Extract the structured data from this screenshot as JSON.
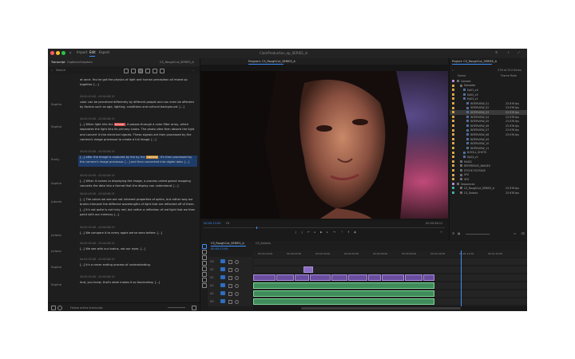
{
  "app": {
    "window_title": "ClarkProduction_ep_SERIES_nl",
    "workspace_tabs": [
      "Import",
      "Edit",
      "Export"
    ],
    "active_workspace": "Edit"
  },
  "left_panel": {
    "tabs": [
      "Transcript",
      "Captions",
      "Graphics"
    ],
    "sequence_name": "CS_RoughCut_SERIES_A",
    "search_placeholder": "Search",
    "footer_label": "Follow active transcript",
    "segments": [
      {
        "speaker": "",
        "timecode": "",
        "text": "at once. You've got the physics of light and human perception all mixed up together. [...]"
      },
      {
        "speaker": "Sophia",
        "timecode": "00:00:05:08 - 00:00:06:19",
        "text": "color can be perceived differently by different people and can even be affected by factors such as age, lighting, conditions and cultural background. [...]"
      },
      {
        "speaker": "Sophia",
        "timecode": "00:00:05:08 - 00:00:06:19",
        "text_before": "[...] When light hits the",
        "highlight": "sensor",
        "text_after": ", it passes through a color filter array, which separates the light into its primary colors. The photo sites then absorb the light and convert it into electrical signals. These signals are then processed by the camera's image processor to create a full image. [...]"
      },
      {
        "speaker": "Emily",
        "timecode": "00:00:05:08 - 00:00:06:19",
        "text_before": "[...] after the image is captured by the by the",
        "highlight": "camera",
        "text_after": ", it's then processed by the camera's image processor. [...] and then converted into digital data. [...]"
      },
      {
        "speaker": "Sophia",
        "timecode": "00:00:05:08 - 00:00:06:19",
        "text": "[...] When it comes to displaying the image, a process called gamut mapping converts the data into a format that the display can understand. [...]"
      },
      {
        "speaker": "Jubrola",
        "timecode": "00:00:05:08 - 00:00:06:19",
        "text": "[...] The colors we see are not inherent properties of optics, but rather way our brains interpret the different wavelengths of light that are reflected off of them. [...] It's not quite is not truly red, but rather a reflection of red light that we then paint with our memory. [...]"
      },
      {
        "speaker": "Juliana",
        "timecode": "00:00:05:08 - 00:00:06:19",
        "text": "[...] We compare it to every apple we've seen before. [...]"
      },
      {
        "speaker": "Juliana",
        "timecode": "00:00:05:08 - 00:00:06:19",
        "text": "[...] We see with our brains, not our eyes. [...]"
      },
      {
        "speaker": "Sophia",
        "timecode": "00:00:05:08 - 00:00:06:19",
        "text": "[...] It's a never ending process of understanding."
      },
      {
        "speaker": "Sophia",
        "timecode": "00:00:05:08 - 00:00:06:19",
        "text": "And, you know, that's what makes it so fascinating. [...]"
      }
    ]
  },
  "program_monitor": {
    "tab": "Program: CS_RoughCut_SERIES_A",
    "timecode_left": "00:00:13:09",
    "fit": "Fit",
    "timecode_right": "00:00:58:11"
  },
  "project_panel": {
    "title": "Project: CS_RoughCut_SERIES_A",
    "items_count": "278 of 314 items",
    "col_name": "Name",
    "col_rate": "Frame Rate",
    "items": [
      {
        "name": "Content",
        "color": "#b98bd6",
        "indent": 0,
        "rate": ""
      },
      {
        "name": "Episodes",
        "color": "#e0a84c",
        "indent": 1,
        "rate": ""
      },
      {
        "name": "Ep01_v4",
        "color": "#e0a84c",
        "indent": 2,
        "rate": ""
      },
      {
        "name": "Ep02_v5",
        "color": "#e0a84c",
        "indent": 2,
        "rate": ""
      },
      {
        "name": "Ep03_v1",
        "color": "#e0a84c",
        "indent": 2,
        "rate": ""
      },
      {
        "name": "INTERVIEW_01",
        "color": "#e0a84c",
        "indent": 3,
        "rate": "23.976 fps"
      },
      {
        "name": "INTERVIEW_02",
        "color": "#e0a84c",
        "indent": 3,
        "rate": "23.976 fps"
      },
      {
        "name": "INTERVIEW_03",
        "color": "#e0a84c",
        "indent": 3,
        "rate": "23.976 fps",
        "selected": true
      },
      {
        "name": "INTERVIEW_04",
        "color": "#e0a84c",
        "indent": 3,
        "rate": "23.976 fps"
      },
      {
        "name": "INTERVIEW_05",
        "color": "#e0a84c",
        "indent": 3,
        "rate": "23.976 fps"
      },
      {
        "name": "INTERVIEW_06",
        "color": "#e0a84c",
        "indent": 3,
        "rate": "23.976 fps"
      },
      {
        "name": "INTERVIEW_07",
        "color": "#e0a84c",
        "indent": 3,
        "rate": "23.976 fps"
      },
      {
        "name": "INTERVIEW_08",
        "color": "#e0a84c",
        "indent": 3,
        "rate": "23.976 fps"
      },
      {
        "name": "INTERVIEW_09",
        "color": "#e0a84c",
        "indent": 3,
        "rate": ""
      },
      {
        "name": "INTERVIEW_10",
        "color": "#e0a84c",
        "indent": 3,
        "rate": ""
      },
      {
        "name": "INTERVIEW_11",
        "color": "#e0a84c",
        "indent": 3,
        "rate": ""
      },
      {
        "name": "B-ROLL_SHOTS",
        "color": "#e0a84c",
        "indent": 2,
        "rate": ""
      },
      {
        "name": "Ep04_v2",
        "color": "#e0a84c",
        "indent": 2,
        "rate": ""
      },
      {
        "name": "MUSIC",
        "color": "#e0a84c",
        "indent": 1,
        "rate": ""
      },
      {
        "name": "REFERENCE_IMAGES",
        "color": "#e0a84c",
        "indent": 1,
        "rate": ""
      },
      {
        "name": "STOCK FOOTAGE",
        "color": "#e0a84c",
        "indent": 1,
        "rate": ""
      },
      {
        "name": "SFX",
        "color": "#e0a84c",
        "indent": 1,
        "rate": ""
      },
      {
        "name": "VFX",
        "color": "#e0a84c",
        "indent": 1,
        "rate": ""
      },
      {
        "name": "Sequences",
        "color": "#b98bd6",
        "indent": 0,
        "rate": ""
      },
      {
        "name": "CS_RoughCut_SERIES_A",
        "color": "#3fb0a8",
        "indent": 1,
        "rate": "23.976 fps"
      },
      {
        "name": "CS_Selects",
        "color": "#3fb0a8",
        "indent": 1,
        "rate": "23.976 fps"
      }
    ]
  },
  "timeline": {
    "tab": "CS_RoughCut_SERIES_A",
    "second_tab": "CS_Selects",
    "timecode": "00:00:13:09",
    "ruler_labels": [
      "00:00:16:00",
      "00:00:24:00",
      "00:00:32:00",
      "00:00:40:00",
      "00:00:48:00",
      "00:00:56:00",
      "00:01:04:00",
      "00:01:12:00",
      "00:01:20:00"
    ],
    "video_tracks": [
      "V3",
      "V2",
      "V1"
    ],
    "audio_tracks": [
      "A1",
      "A2",
      "A3"
    ]
  }
}
